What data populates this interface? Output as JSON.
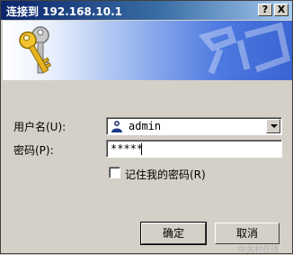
{
  "window": {
    "title": "连接到 192.168.10.1",
    "help_label": "?",
    "close_label": "X"
  },
  "form": {
    "username_label": "用户名(U):",
    "username_value": "admin",
    "password_label": "密码(P):",
    "password_value": "*****",
    "remember_label": "记住我的密码(R)"
  },
  "buttons": {
    "ok": "确定",
    "cancel": "取消"
  },
  "watermark": {
    "text": "中关村在线"
  },
  "colors": {
    "titlebar_start": "#0a246a",
    "titlebar_end": "#a6caf0",
    "banner_blue": "#3a64d2",
    "dialog_gray": "#d4d0c8"
  },
  "icons": [
    "keys-icon",
    "user-icon",
    "chevron-down-icon"
  ]
}
